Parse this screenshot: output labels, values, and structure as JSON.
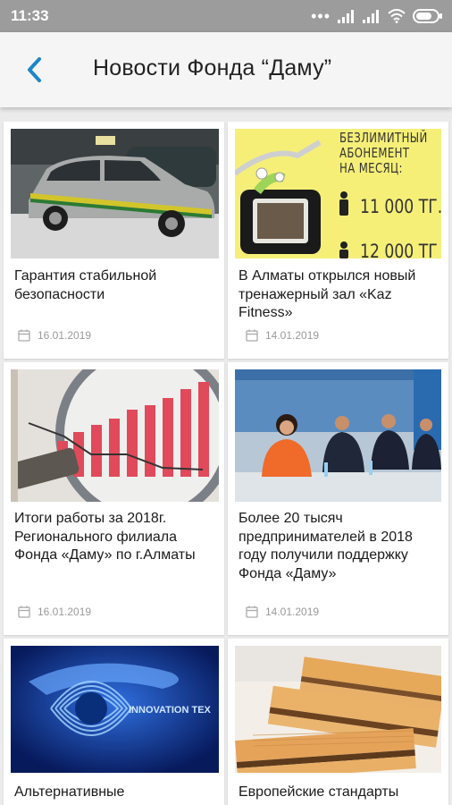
{
  "status": {
    "time": "11:33"
  },
  "header": {
    "title": "Новости Фонда “Даму”"
  },
  "news": [
    {
      "title": "Гарантия стабильной безопасности",
      "date": "16.01.2019"
    },
    {
      "title": "В Алматы открылся новый тренажерный зал «Kaz Fitness»",
      "date": "14.01.2019",
      "image_text": {
        "line1": "БЕЗЛИМИТНЫЙ",
        "line2": "АБОНЕМЕНТ",
        "line3": "НА МЕСЯЦ:",
        "price1": "11 000 ТГ.",
        "price2": "12 000 ТГ"
      }
    },
    {
      "title": "Итоги работы за 2018г. Регионального филиала Фонда «Даму» по г.Алматы",
      "date": "16.01.2019"
    },
    {
      "title": "Более 20 тысяч предпринимателей в 2018 году получили поддержку Фонда «Даму»",
      "date": "14.01.2019"
    },
    {
      "title": "Альтернативные",
      "date": "",
      "image_text": {
        "caption": "INNOVATION TEX"
      }
    },
    {
      "title": "Европейские стандарты",
      "date": ""
    }
  ]
}
